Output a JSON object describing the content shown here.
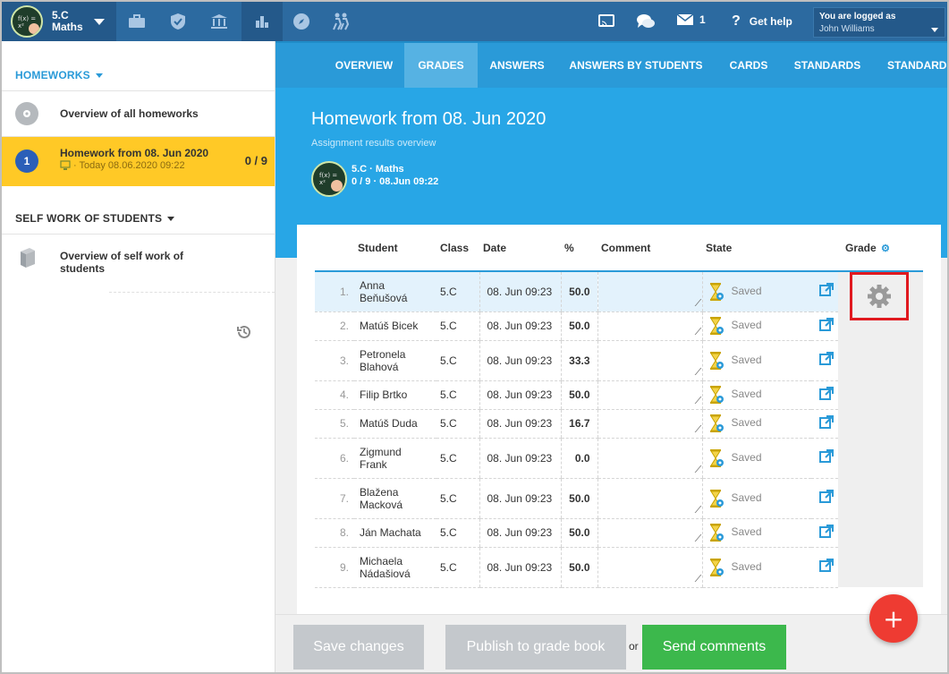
{
  "topbar": {
    "class_line1": "5.C",
    "class_line2": "Maths",
    "messages_count": "1",
    "help_label": "Get help",
    "logged_label": "You are logged as",
    "user_name": "John Williams"
  },
  "sidebar": {
    "homeworks_header": "HOMEWORKS",
    "overview_all": "Overview of all homeworks",
    "active_homework": {
      "number": "1",
      "title": "Homework from 08. Jun 2020",
      "meta": "· Today 08.06.2020 09:22",
      "score": "0 / 9"
    },
    "self_work_header": "SELF WORK OF STUDENTS",
    "self_work_item": "Overview of self work of students"
  },
  "tabs": [
    "OVERVIEW",
    "GRADES",
    "ANSWERS",
    "ANSWERS BY STUDENTS",
    "CARDS",
    "STANDARDS",
    "STANDARDS"
  ],
  "hero": {
    "title": "Homework from 08. Jun 2020",
    "subtitle": "Assignment results overview",
    "class_name": "5.C · Maths",
    "class_meta": "0 / 9 · 08.Jun 09:22"
  },
  "table": {
    "headers": {
      "student": "Student",
      "class": "Class",
      "date": "Date",
      "pct": "%",
      "comment": "Comment",
      "state": "State",
      "grade": "Grade"
    },
    "rows": [
      {
        "n": "1.",
        "student": "Anna Beňušová",
        "class": "5.C",
        "date": "08. Jun 09:23",
        "pct": "50.0",
        "state": "Saved"
      },
      {
        "n": "2.",
        "student": "Matúš Bicek",
        "class": "5.C",
        "date": "08. Jun 09:23",
        "pct": "50.0",
        "state": "Saved"
      },
      {
        "n": "3.",
        "student": "Petronela Blahová",
        "class": "5.C",
        "date": "08. Jun 09:23",
        "pct": "33.3",
        "state": "Saved"
      },
      {
        "n": "4.",
        "student": "Filip Brtko",
        "class": "5.C",
        "date": "08. Jun 09:23",
        "pct": "50.0",
        "state": "Saved"
      },
      {
        "n": "5.",
        "student": "Matúš Duda",
        "class": "5.C",
        "date": "08. Jun 09:23",
        "pct": "16.7",
        "state": "Saved"
      },
      {
        "n": "6.",
        "student": "Zigmund Frank",
        "class": "5.C",
        "date": "08. Jun 09:23",
        "pct": "0.0",
        "state": "Saved"
      },
      {
        "n": "7.",
        "student": "Blažena Macková",
        "class": "5.C",
        "date": "08. Jun 09:23",
        "pct": "50.0",
        "state": "Saved"
      },
      {
        "n": "8.",
        "student": "Ján Machata",
        "class": "5.C",
        "date": "08. Jun 09:23",
        "pct": "50.0",
        "state": "Saved"
      },
      {
        "n": "9.",
        "student": "Michaela Nádašiová",
        "class": "5.C",
        "date": "08. Jun 09:23",
        "pct": "50.0",
        "state": "Saved"
      }
    ]
  },
  "buttons": {
    "save": "Save changes",
    "publish": "Publish to grade book",
    "or": "or",
    "send": "Send comments",
    "fab": "+"
  },
  "colors": {
    "accent": "#2a9ad8",
    "green": "#3cb84c",
    "red": "#ee3b32",
    "topbar": "#2c6aa0",
    "highlight": "#e0191f"
  }
}
